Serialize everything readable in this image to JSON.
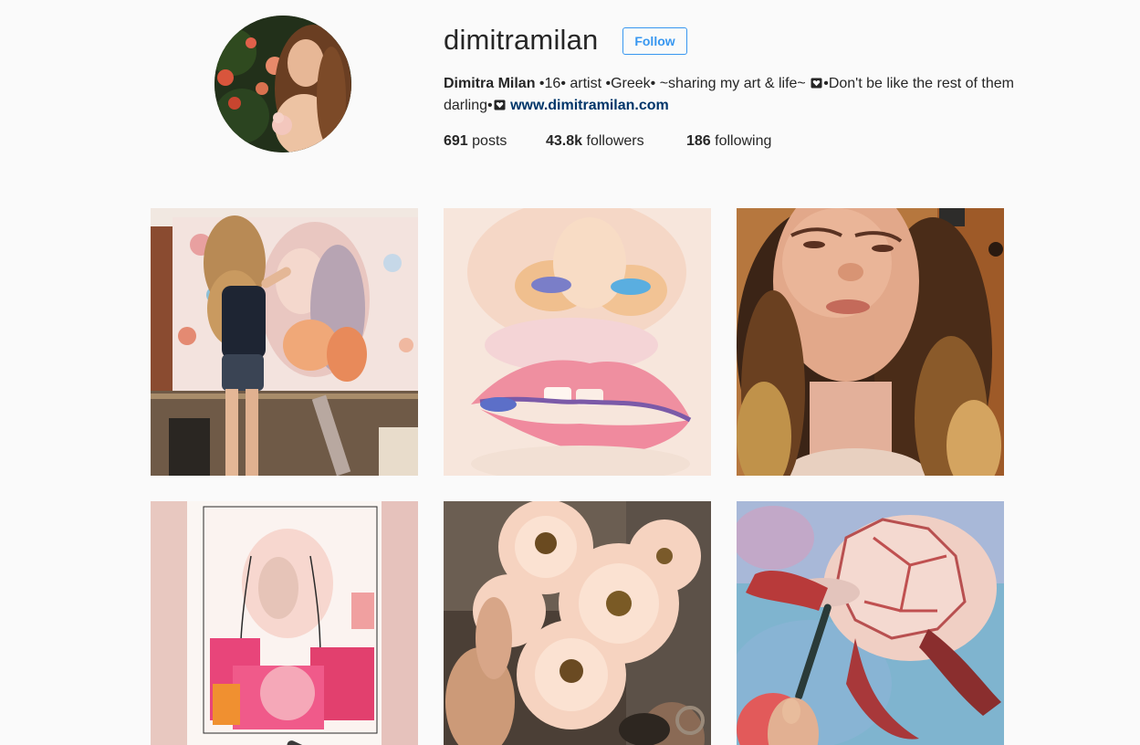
{
  "profile": {
    "username": "dimitramilan",
    "follow_label": "Follow",
    "avatar_icon": "profile-photo",
    "bio": {
      "name": "Dimitra Milan",
      "text_part1": " •16• artist •Greek• ~sharing my art & life~ ",
      "text_part2": "•Don't be like the rest of them darling•",
      "heart_icon": "heart-icon",
      "link": "www.dimitramilan.com"
    },
    "stats": {
      "posts_count": "691",
      "posts_label": " posts",
      "followers_count": "43.8k",
      "followers_label": " followers",
      "following_count": "186",
      "following_label": " following"
    }
  },
  "colors": {
    "background": "#fafafa",
    "accent": "#3897f0",
    "link": "#003569",
    "text": "#262626"
  },
  "posts": [
    {
      "id": "post-1",
      "subject": "artist-painting-canvas-photo"
    },
    {
      "id": "post-2",
      "subject": "painted-lips-and-nose-closeup"
    },
    {
      "id": "post-3",
      "subject": "selfie-portrait-photo"
    },
    {
      "id": "post-4",
      "subject": "watercolor-portrait-sketch"
    },
    {
      "id": "post-5",
      "subject": "pink-gerbera-bouquet-photo"
    },
    {
      "id": "post-6",
      "subject": "sea-turtle-painting"
    }
  ]
}
